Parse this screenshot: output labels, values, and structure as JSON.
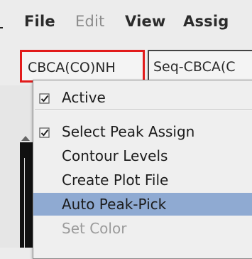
{
  "menubar": {
    "items": [
      {
        "label": "File",
        "enabled": true
      },
      {
        "label": "Edit",
        "enabled": false
      },
      {
        "label": "View",
        "enabled": true
      },
      {
        "label": "Assig",
        "enabled": true
      }
    ]
  },
  "tabs": [
    {
      "label": "CBCA(CO)NH",
      "selected": true
    },
    {
      "label": "Seq-CBCA(C",
      "selected": false
    }
  ],
  "context_menu": {
    "items": [
      {
        "label": "Active",
        "checked": true,
        "enabled": true,
        "highlighted": false
      },
      {
        "label": "Select Peak Assign",
        "checked": true,
        "enabled": true,
        "highlighted": false
      },
      {
        "label": "Contour Levels",
        "checked": false,
        "enabled": true,
        "highlighted": false
      },
      {
        "label": "Create Plot File",
        "checked": false,
        "enabled": true,
        "highlighted": false
      },
      {
        "label": "Auto Peak-Pick",
        "checked": false,
        "enabled": true,
        "highlighted": true
      },
      {
        "label": "Set Color",
        "checked": false,
        "enabled": false,
        "highlighted": false
      }
    ]
  },
  "colors": {
    "selected_tab_border": "#e21b1b",
    "highlight": "#8faad2",
    "disabled_text": "#9a9a9a"
  }
}
